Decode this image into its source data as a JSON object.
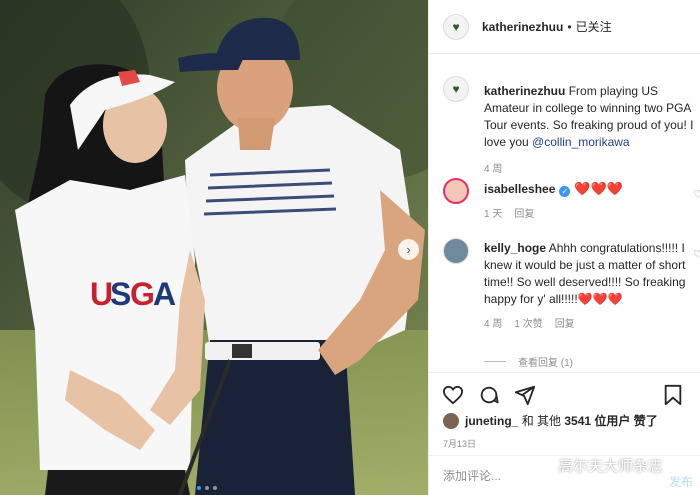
{
  "colors": {
    "link": "#1e3f88",
    "heart": "#e8253a",
    "muted": "#8e8e8e",
    "verified": "#3897f0",
    "post_disabled": "#b2dffc"
  },
  "photo": {
    "alt_logo_text": "USGA",
    "carousel": {
      "total": 3,
      "active_index": 0
    }
  },
  "header": {
    "username": "katherinezhuu",
    "separator": "•",
    "follow_status": "已关注"
  },
  "caption": {
    "author": "katherinezhuu",
    "text": "From playing US Amateur in college to winning two PGA Tour events. So freaking proud of you! I love you",
    "mention": "@collin_morikawa",
    "age": "4 周"
  },
  "comments": [
    {
      "author": "isabelleshee",
      "verified": true,
      "text": "❤️❤️❤️",
      "age": "1 天",
      "reply": "回复"
    },
    {
      "author": "kelly_hoge",
      "verified": false,
      "text": "Ahhh congratulations!!!!! I knew it would be just a matter of short time!! So well deserved!!!! So freaking happy for y' all!!!!!❤️❤️❤️",
      "age": "4 周",
      "likes": "1 次赞",
      "reply": "回复",
      "view_replies": "查看回复 (1)"
    }
  ],
  "likes": {
    "user": "juneting_",
    "connector": "和 其他",
    "count": "3541",
    "suffix": "位用户 赞了"
  },
  "date": "7月13日",
  "compose": {
    "placeholder": "添加评论...",
    "post_label": "发布"
  },
  "watermark": {
    "text": "高尔夫大师杂志"
  },
  "icons": {
    "like": "heart-icon",
    "comment": "comment-icon",
    "share": "share-icon",
    "save": "bookmark-icon",
    "next": "chevron-right-icon"
  }
}
